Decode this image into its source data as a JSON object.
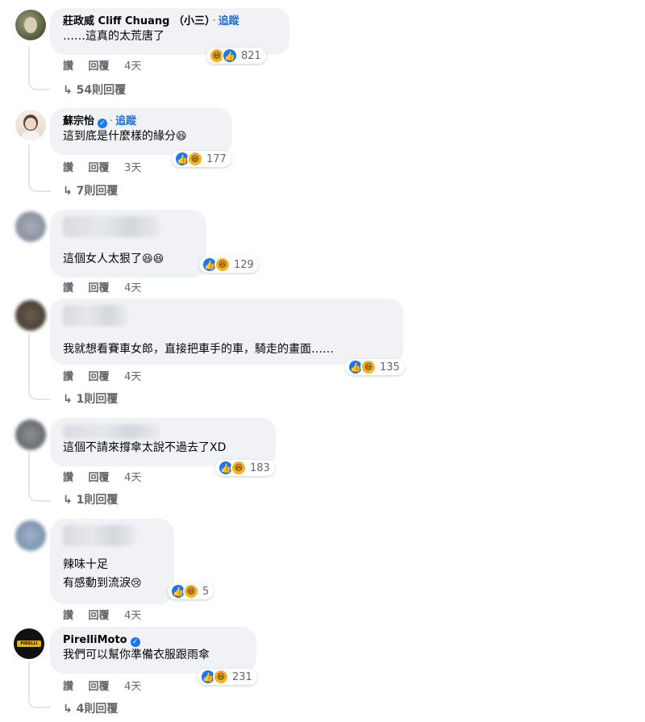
{
  "comments": [
    {
      "name": "莊政威 Cliff Chuang （小三）",
      "follow": "追蹤",
      "text": "……這真的太荒唐了",
      "reaction_count": "821",
      "actions": {
        "like": "讚",
        "reply": "回覆",
        "time": "4天"
      },
      "replies": "54則回覆",
      "reactions": [
        "haha",
        "like"
      ]
    },
    {
      "name": "蘇宗怡",
      "follow": "追蹤",
      "text": "這到底是什麼樣的緣分",
      "reaction_count": "177",
      "actions": {
        "like": "讚",
        "reply": "回覆",
        "time": "3天"
      },
      "replies": "7則回覆",
      "reactions": [
        "like",
        "haha"
      ]
    },
    {
      "text": "這個女人太狠了",
      "reaction_count": "129",
      "actions": {
        "like": "讚",
        "reply": "回覆",
        "time": "4天"
      }
    },
    {
      "text": "我就想看賽車女郎，直接把車手的車，騎走的畫面……",
      "reaction_count": "135",
      "actions": {
        "like": "讚",
        "reply": "回覆",
        "time": "4天"
      },
      "replies": "1則回覆"
    },
    {
      "text": "這個不請來撐傘太說不過去了XD",
      "reaction_count": "183",
      "actions": {
        "like": "讚",
        "reply": "回覆",
        "time": "4天"
      },
      "replies": "1則回覆"
    },
    {
      "text_line1": "辣味十足",
      "text_line2": "有感動到流淚",
      "reaction_count": "5",
      "actions": {
        "like": "讚",
        "reply": "回覆",
        "time": "4天"
      }
    },
    {
      "name": "PirelliMoto",
      "text": "我們可以幫你準備衣服跟雨傘",
      "reaction_count": "231",
      "actions": {
        "like": "讚",
        "reply": "回覆",
        "time": "4天"
      },
      "replies": "4則回覆"
    }
  ],
  "icons": {
    "reply_arrow": "↳",
    "like": "👍",
    "haha": "😆",
    "cry": "😢",
    "verified": "✓"
  },
  "colors": {
    "bubble": "#f0f2f5",
    "link": "#216fdb",
    "secondary": "#65676b",
    "like": "#1877f2",
    "haha": "#f7b125"
  },
  "pirelli_logo": "PIRELLI"
}
